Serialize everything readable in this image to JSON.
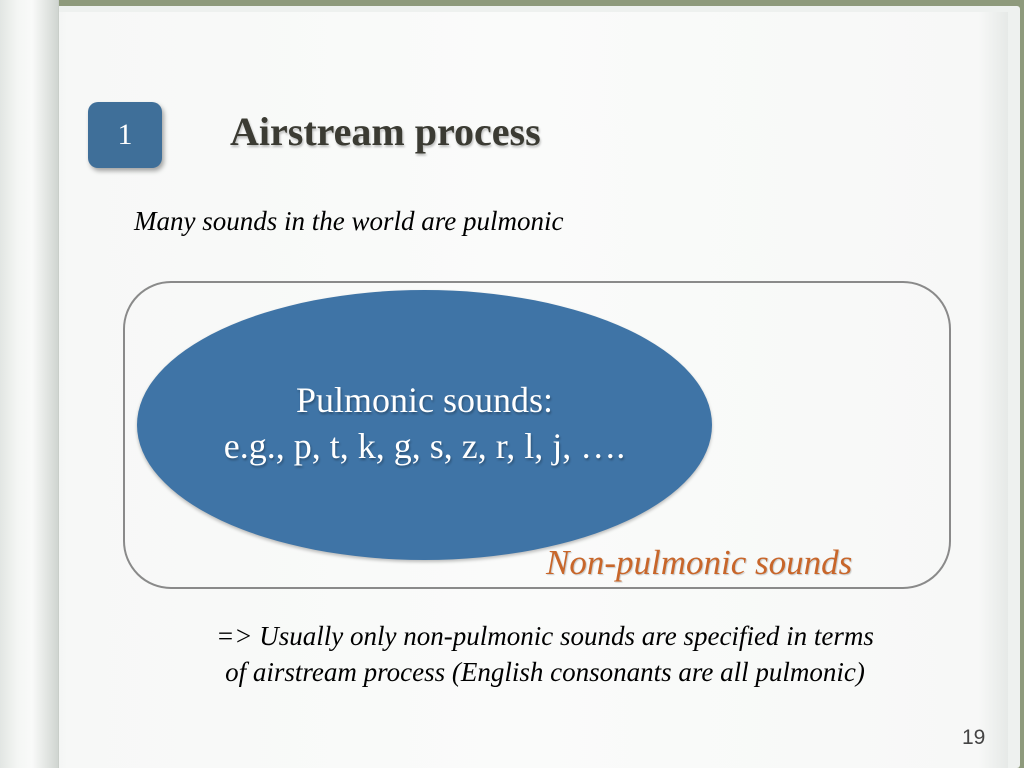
{
  "slide": {
    "badge_number": "1",
    "title": "Airstream process",
    "subtitle": "Many sounds in the world are pulmonic",
    "diagram": {
      "inner_label_line1": "Pulmonic sounds:",
      "inner_label_line2": "e.g., p, t, k, g, s, z, r, l, j, ….",
      "outer_label": "Non-pulmonic sounds"
    },
    "note_line1": "=> Usually only non-pulmonic sounds are specified in terms",
    "note_line2": "of airstream process (English consonants are all pulmonic)",
    "page_number": "19"
  },
  "colors": {
    "badge": "#3f6f99",
    "ellipse": "#3f74a6",
    "outer_label": "#c8662a",
    "title": "#3b3b33"
  }
}
